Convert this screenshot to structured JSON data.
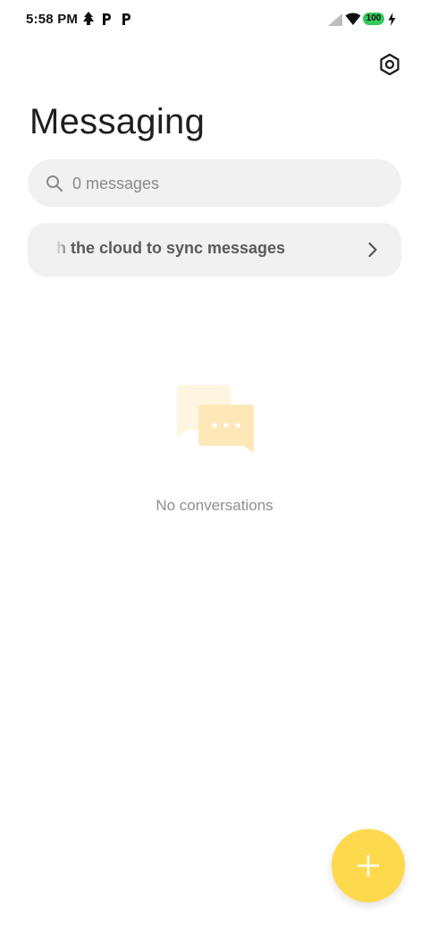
{
  "status_bar": {
    "time": "5:58 PM",
    "battery_level": "100",
    "notification_icons": [
      "tree-notification-icon",
      "p-app-icon",
      "p-app-icon"
    ],
    "signal": "cellular-signal-icon",
    "wifi": "wifi-icon",
    "charging": "charging-bolt-icon"
  },
  "header": {
    "title": "Messaging",
    "settings_icon": "settings-hex-icon"
  },
  "search": {
    "placeholder": "0 messages",
    "value": ""
  },
  "sync_banner": {
    "text": "Sync with the cloud to sync messages",
    "visible_text": "th the cloud to sync messages",
    "icon": "chevron-right-icon"
  },
  "empty_state": {
    "illustration": "chat-bubbles-icon",
    "text": "No conversations"
  },
  "fab": {
    "icon": "plus-icon",
    "color": "#ffd94d"
  },
  "colors": {
    "accent": "#ffd94d",
    "surface": "#f1f1f1",
    "battery": "#35c759"
  }
}
